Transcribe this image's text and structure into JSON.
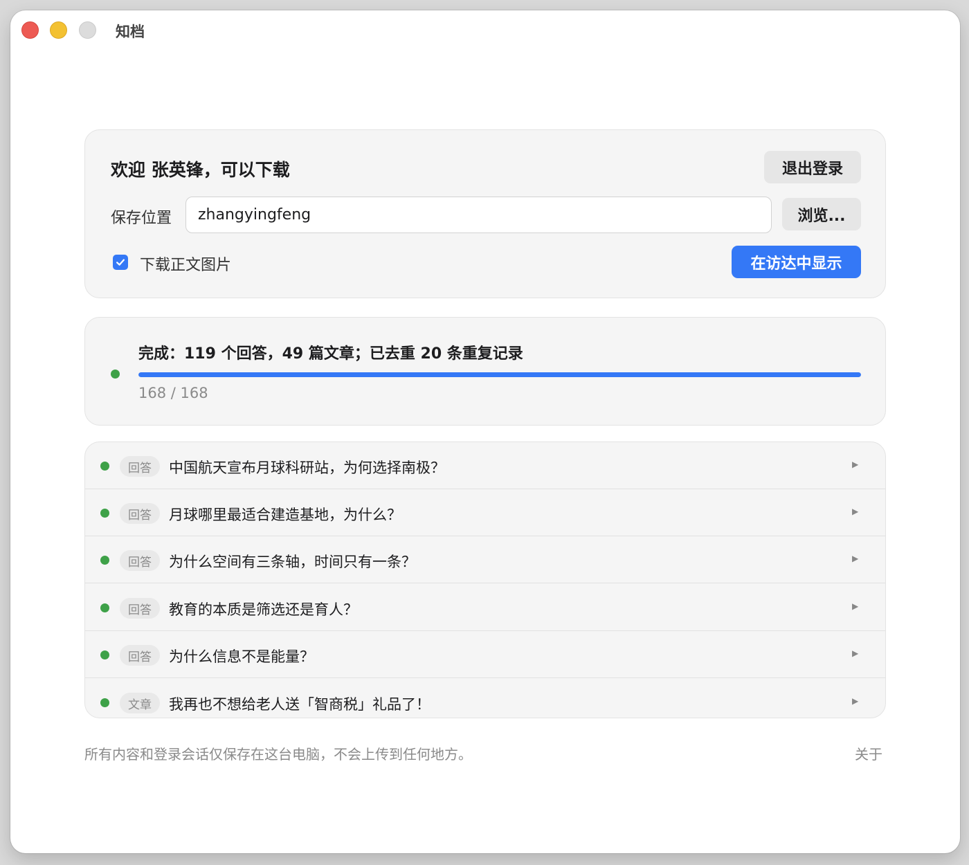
{
  "window": {
    "title": "知档"
  },
  "login": {
    "welcome": "欢迎 张英锋，可以下载",
    "logout_label": "退出登录",
    "save_location_label": "保存位置",
    "save_location_value": "zhangyingfeng",
    "browse_label": "浏览...",
    "download_images_label": "下载正文图片",
    "download_images_checked": true,
    "show_in_finder_label": "在访达中显示"
  },
  "progress": {
    "status": "完成：119 个回答，49 篇文章；已去重 20 条重复记录",
    "count": "168 / 168",
    "fraction": 1.0
  },
  "items": [
    {
      "tag": "回答",
      "title": "中国航天宣布月球科研站，为何选择南极？"
    },
    {
      "tag": "回答",
      "title": "月球哪里最适合建造基地，为什么？"
    },
    {
      "tag": "回答",
      "title": "为什么空间有三条轴，时间只有一条？"
    },
    {
      "tag": "回答",
      "title": "教育的本质是筛选还是育人？"
    },
    {
      "tag": "回答",
      "title": "为什么信息不是能量？"
    },
    {
      "tag": "文章",
      "title": "我再也不想给老人送「智商税」礼品了！"
    }
  ],
  "footer": {
    "note": "所有内容和登录会话仅保存在这台电脑，不会上传到任何地方。",
    "about_label": "关于"
  },
  "colors": {
    "accent": "#3478f6",
    "status_done": "#3ea148"
  },
  "icons": [
    "close-button",
    "minimize-button",
    "zoom-button",
    "checkmark-icon",
    "status-dot-icon",
    "disclosure-arrow-icon"
  ]
}
